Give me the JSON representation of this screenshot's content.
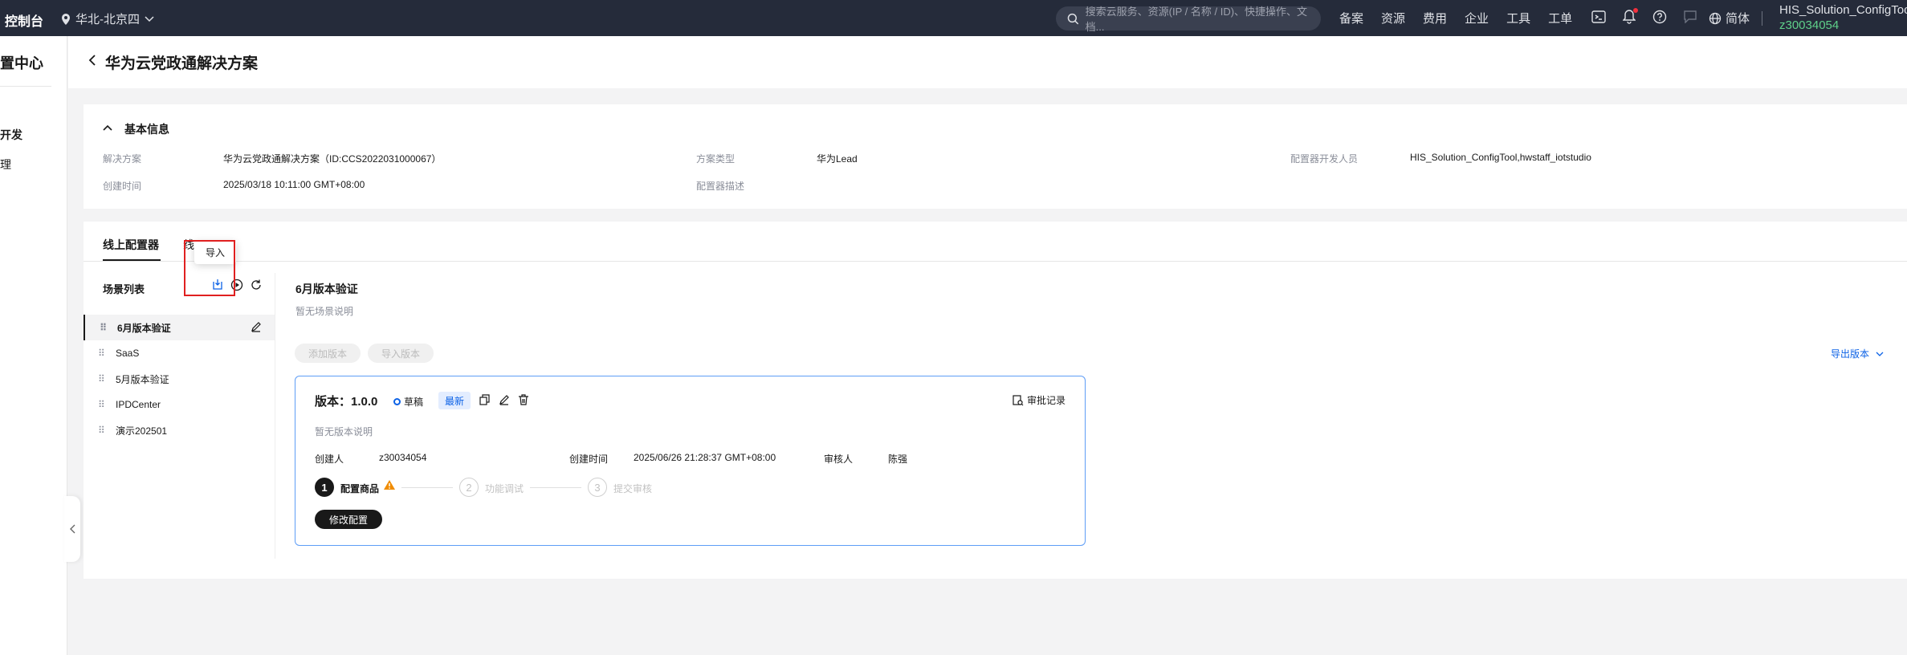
{
  "topbar": {
    "console": "控制台",
    "region": "华北-北京四",
    "search_placeholder": "搜索云服务、资源(IP / 名称 / ID)、快捷操作、文档...",
    "links": [
      "备案",
      "资源",
      "费用",
      "企业",
      "工具",
      "工单"
    ],
    "language": "简体",
    "username": "HIS_Solution_ConfigTool",
    "userid": "z30034054"
  },
  "sidebar": {
    "title": "置中心",
    "items": [
      "开发",
      "理"
    ]
  },
  "page": {
    "title": "华为云党政通解决方案"
  },
  "basic_info": {
    "heading": "基本信息",
    "fields": {
      "solution_label": "解决方案",
      "solution_value": "华为云党政通解决方案（ID:CCS2022031000067）",
      "type_label": "方案类型",
      "type_value": "华为Lead",
      "developer_label": "配置器开发人员",
      "developer_value": "HIS_Solution_ConfigTool,hwstaff_iotstudio",
      "created_label": "创建时间",
      "created_value": "2025/03/18 10:11:00 GMT+08:00",
      "desc_label": "配置器描述"
    }
  },
  "tabs": {
    "online": "线上配置器",
    "offline": "线"
  },
  "tooltip": "导入",
  "scenes": {
    "title": "场景列表",
    "items": [
      "6月版本验证",
      "SaaS",
      "5月版本验证",
      "IPDCenter",
      "演示202501"
    ]
  },
  "detail": {
    "title": "6月版本验证",
    "desc": "暂无场景说明",
    "add_version": "添加版本",
    "import_version": "导入版本",
    "export_version": "导出版本"
  },
  "version": {
    "title": "版本：1.0.0",
    "status": "草稿",
    "badge": "最新",
    "audit": "审批记录",
    "desc": "暂无版本说明",
    "creator_label": "创建人",
    "creator_value": "z30034054",
    "created_label": "创建时间",
    "created_value": "2025/06/26 21:28:37 GMT+08:00",
    "reviewer_label": "审核人",
    "reviewer_value": "陈强",
    "steps": [
      {
        "num": "1",
        "label": "配置商品"
      },
      {
        "num": "2",
        "label": "功能调试"
      },
      {
        "num": "3",
        "label": "提交审核"
      }
    ],
    "modify": "修改配置"
  }
}
